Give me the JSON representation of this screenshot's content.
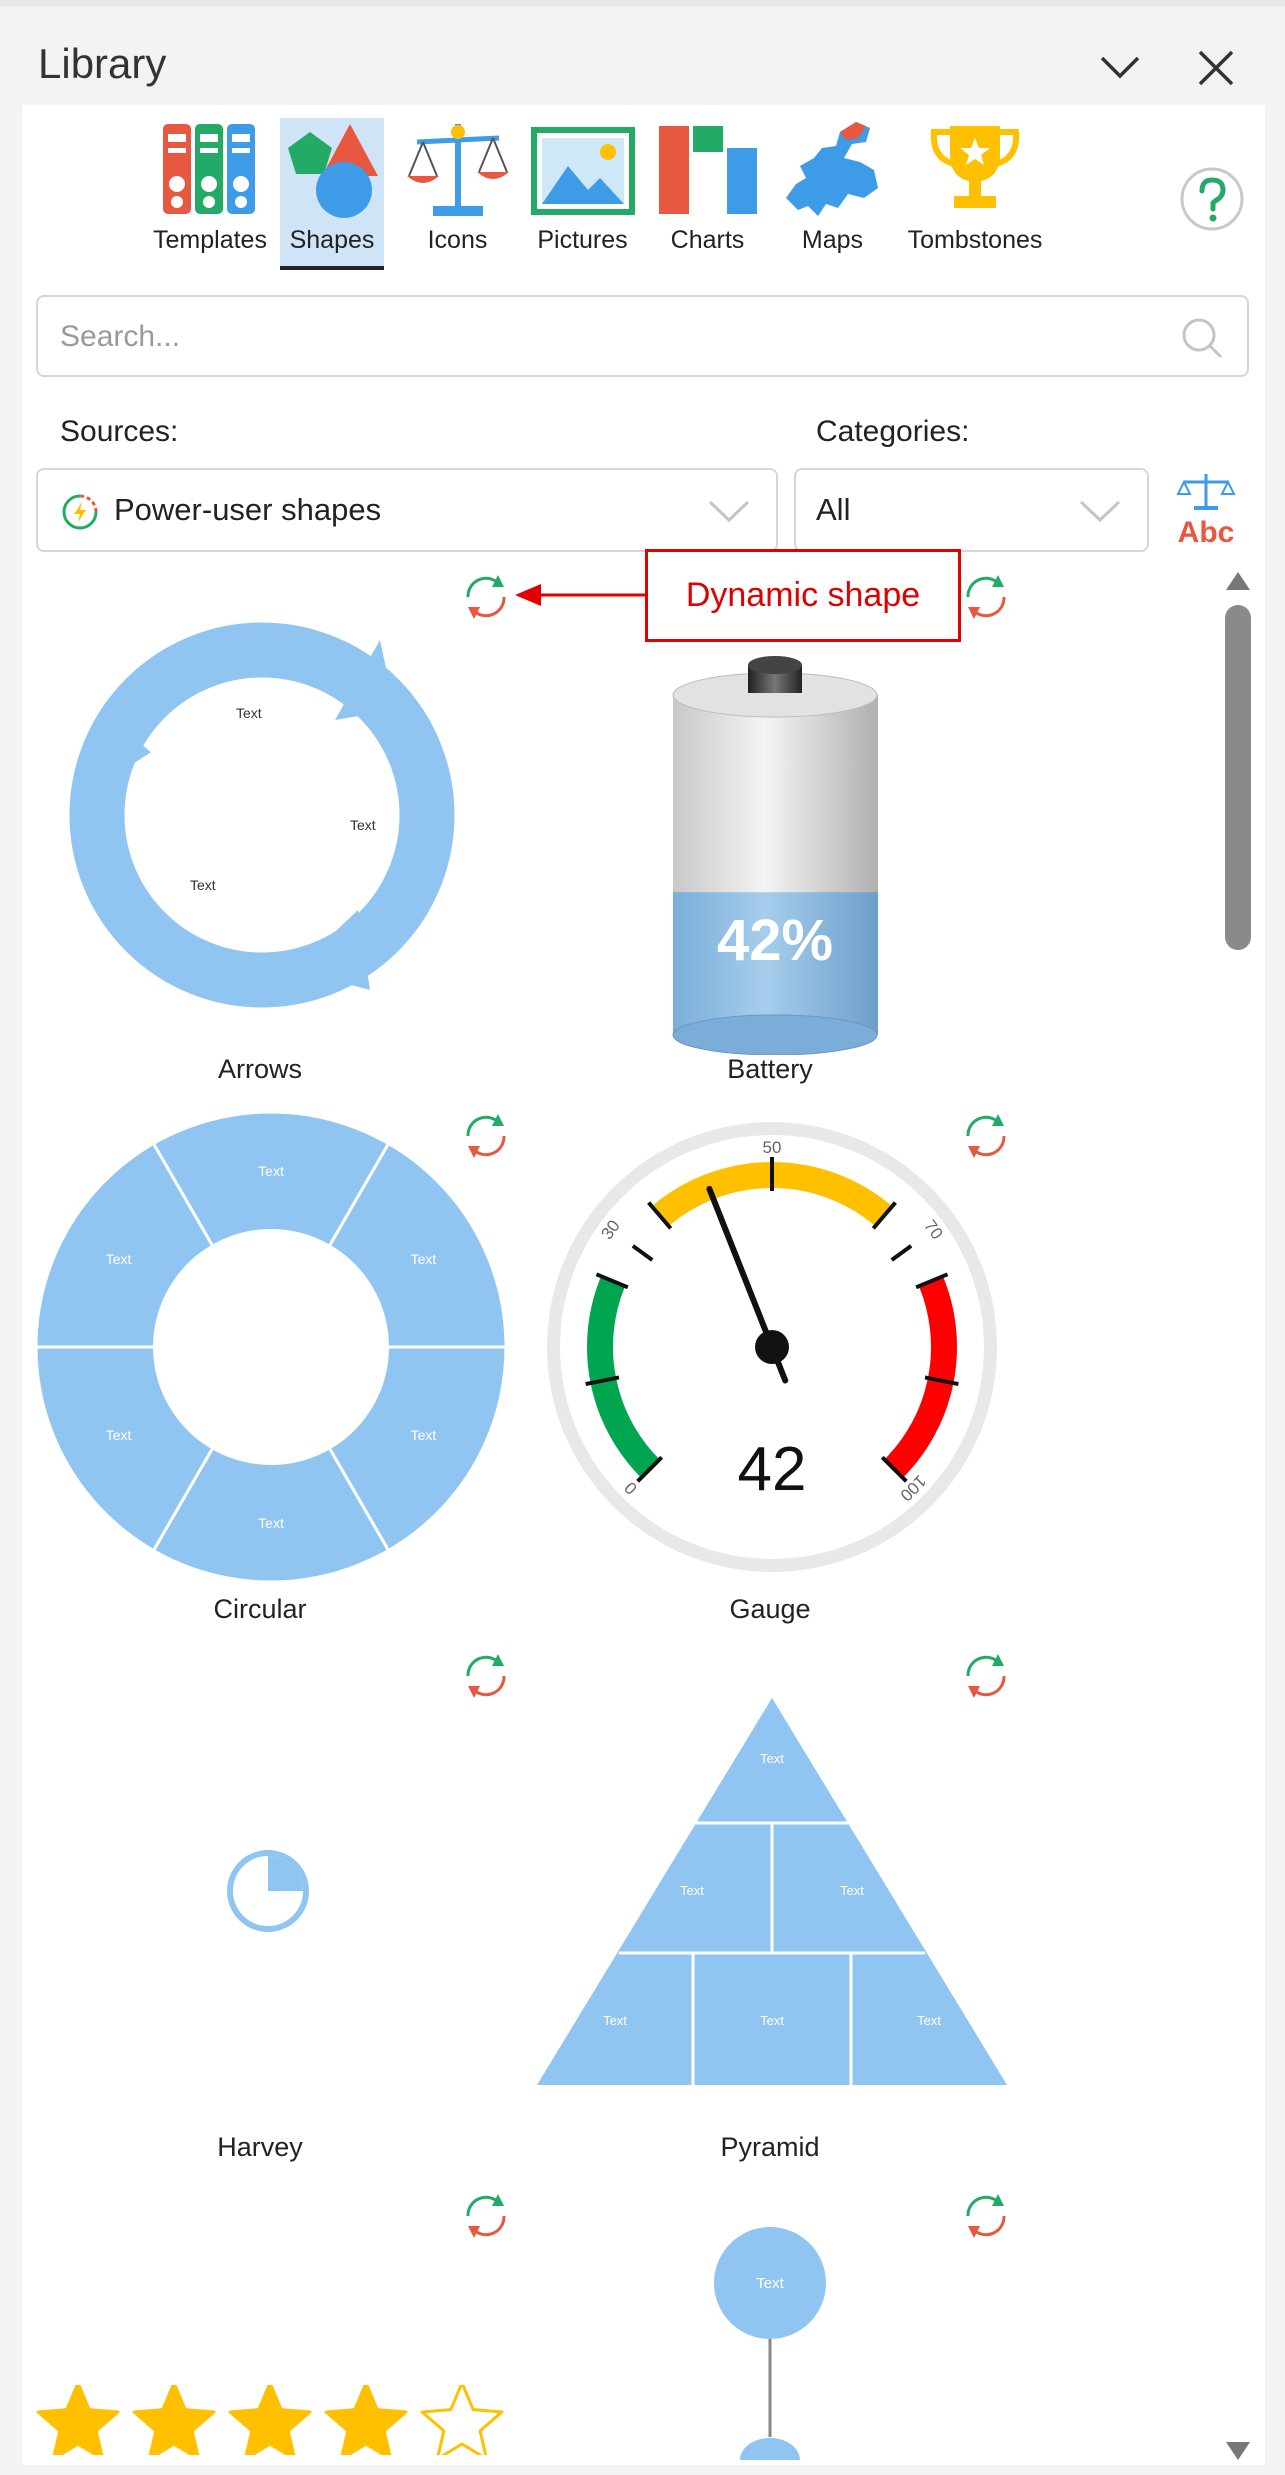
{
  "pane": {
    "title": "Library"
  },
  "tabs": [
    {
      "label": "Templates",
      "icon": "binders-icon"
    },
    {
      "label": "Shapes",
      "icon": "shapes-icon",
      "active": true
    },
    {
      "label": "Icons",
      "icon": "scales-icon"
    },
    {
      "label": "Pictures",
      "icon": "picture-icon"
    },
    {
      "label": "Charts",
      "icon": "bar-chart-icon"
    },
    {
      "label": "Maps",
      "icon": "europe-map-icon"
    },
    {
      "label": "Tombstones",
      "icon": "trophy-icon"
    }
  ],
  "search": {
    "placeholder": "Search...",
    "value": ""
  },
  "filters": {
    "sources_label": "Sources:",
    "sources_value": "Power-user shapes",
    "categories_label": "Categories:",
    "categories_value": "All"
  },
  "callout": {
    "text": "Dynamic shape"
  },
  "shapes": [
    {
      "name": "Arrows",
      "dynamic": true,
      "inner_text": "Text"
    },
    {
      "name": "Battery",
      "dynamic": true,
      "level": 0.42,
      "display": "42%"
    },
    {
      "name": "Circular",
      "dynamic": true,
      "inner_text": "Text"
    },
    {
      "name": "Gauge",
      "dynamic": true,
      "value": 42,
      "display": "42",
      "scale_labels": [
        "0",
        "30",
        "50",
        "70",
        "100"
      ]
    },
    {
      "name": "Harvey",
      "dynamic": true,
      "fill": 0.25
    },
    {
      "name": "Pyramid",
      "dynamic": true,
      "inner_text": "Text"
    },
    {
      "name": "",
      "dynamic": true,
      "rating": 4,
      "max_rating": 5
    },
    {
      "name": "",
      "dynamic": true,
      "inner_text": "Text"
    }
  ],
  "colors": {
    "shape_blue": "#90c5f2",
    "accent_red": "#e00000",
    "gauge_yellow": "#ffc000",
    "gauge_green": "#00a550",
    "gauge_red": "#ff0000",
    "star_yellow": "#ffc000"
  }
}
